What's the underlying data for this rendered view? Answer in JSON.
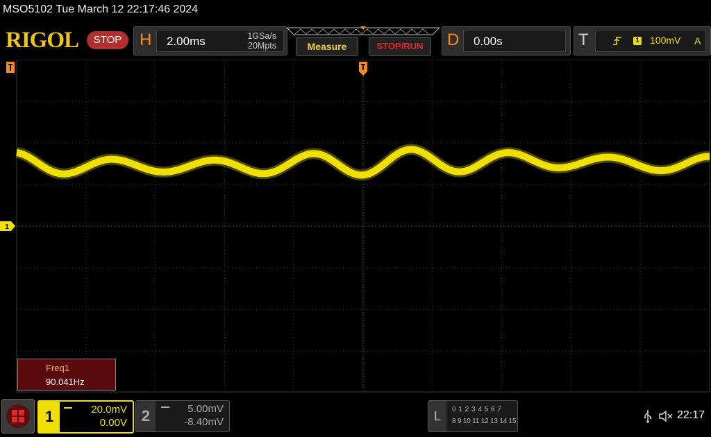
{
  "title_bar": {
    "text": "MSO5102  Tue March 12 22:17:46 2024"
  },
  "header": {
    "logo": "RIGOL",
    "run_status": "STOP",
    "horizontal": {
      "letter": "H",
      "timebase": "2.00ms",
      "sample_rate": "1GSa/s",
      "memory_depth": "20Mpts"
    },
    "measure_button": "Measure",
    "stoprun_button": "STOP/RUN",
    "delay": {
      "letter": "D",
      "value": "0.00s"
    },
    "trigger": {
      "letter": "T",
      "source": "1",
      "level": "100mV",
      "mode": "A"
    }
  },
  "screen": {
    "markers": {
      "ch1_ground": "1"
    },
    "measurement": {
      "label": "Freq1",
      "value": "90.041Hz"
    },
    "trace_color": "#f0e000",
    "grid_color": "#3a3a3a"
  },
  "footer": {
    "ch1": {
      "number": "1",
      "scale": "20.0mV",
      "offset": "0.00V",
      "color": "#f0e000"
    },
    "ch2": {
      "number": "2",
      "scale": "5.00mV",
      "offset": "-8.40mV"
    },
    "logic": {
      "letter": "L",
      "row1": "0 1 2 3  4 5 6 7",
      "row2": "8 9 10 11 12 13 14 15"
    },
    "icons": {
      "usb": "usb-icon",
      "sound": "mute-icon",
      "menu": "menu-icon"
    },
    "clock": "22:17"
  }
}
